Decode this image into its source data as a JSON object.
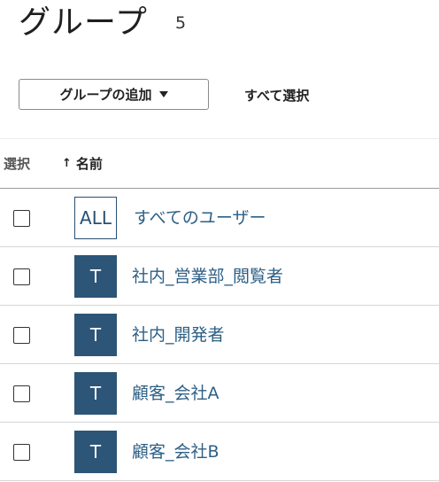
{
  "header": {
    "title": "グループ",
    "count": "5"
  },
  "toolbar": {
    "add_group_label": "グループの追加",
    "select_all_label": "すべて選択"
  },
  "table": {
    "columns": {
      "select": "選択",
      "name": "名前",
      "sort_indicator": "↑"
    },
    "rows": [
      {
        "avatar": "ALL",
        "avatar_style": "outline",
        "name": "すべてのユーザー"
      },
      {
        "avatar": "T",
        "avatar_style": "solid",
        "name": "社内_営業部_閲覧者"
      },
      {
        "avatar": "T",
        "avatar_style": "solid",
        "name": "社内_開発者"
      },
      {
        "avatar": "T",
        "avatar_style": "solid",
        "name": "顧客_会社A"
      },
      {
        "avatar": "T",
        "avatar_style": "solid",
        "name": "顧客_会社B"
      }
    ]
  },
  "colors": {
    "avatar_bg": "#2c5577",
    "link": "#2c5f85"
  },
  "icons": {
    "dropdown": "caret-down-icon",
    "sort": "arrow-up-icon",
    "checkbox": "checkbox-icon"
  }
}
